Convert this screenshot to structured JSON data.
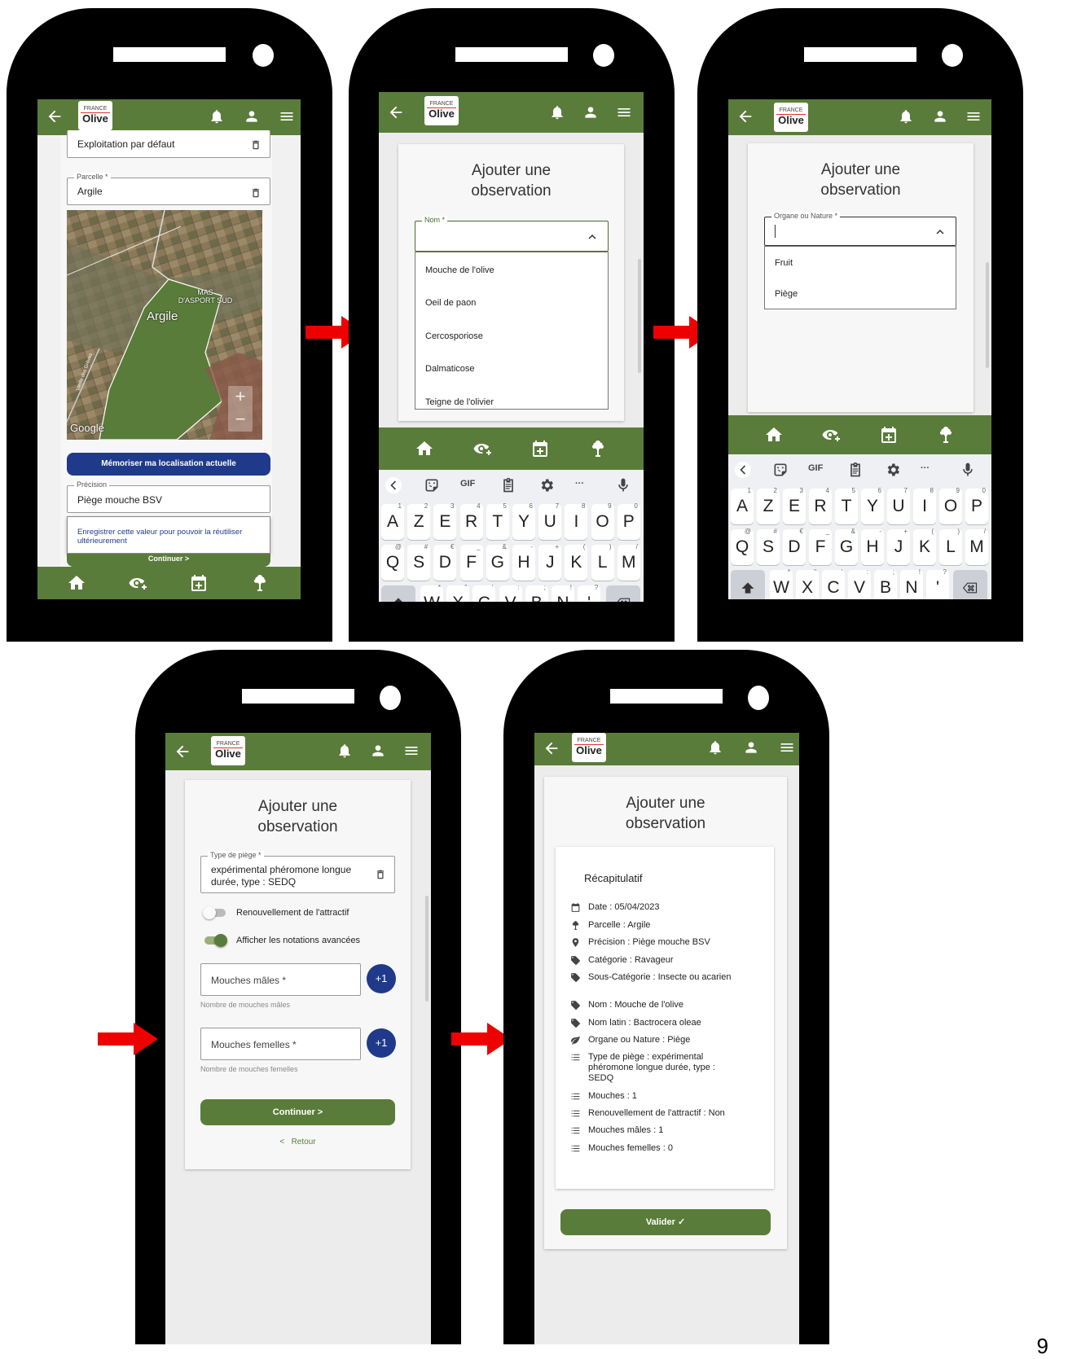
{
  "brand": {
    "logo_top": "FRANCE",
    "logo_main": "Olive"
  },
  "colors": {
    "green": "#5a7c3a",
    "blue": "#1f3a8a",
    "arrow": "#ee0000"
  },
  "screen1": {
    "exploitation_value": "Exploitation par défaut",
    "parcelle_label": "Parcelle *",
    "parcelle_value": "Argile",
    "map": {
      "mas_label": "MAS\nD'ASPORT SUD",
      "parcel_label": "Argile",
      "google": "Google",
      "road": "Vieille des Grèves",
      "zoom_in": "+",
      "zoom_out": "−"
    },
    "memorise_button": "Mémoriser ma localisation actuelle",
    "precision_label": "Précision",
    "precision_value": "Piège mouche BSV",
    "suggestion": "Enregistrer cette valeur pour pouvoir la réutiliser ultérieurement",
    "continue_button": "Continuer  >"
  },
  "screen2": {
    "title": "Ajouter une observation",
    "nom_label": "Nom *",
    "options": [
      "Mouche de l'olive",
      "Oeil de paon",
      "Cercosporiose",
      "Dalmaticose",
      "Teigne de l'olivier"
    ]
  },
  "screen3": {
    "title": "Ajouter une observation",
    "organe_label": "Organe ou Nature *",
    "options": [
      "Fruit",
      "Piège"
    ]
  },
  "keyboard": {
    "tools": [
      "GIF",
      "···"
    ],
    "row1": [
      "A",
      "Z",
      "E",
      "R",
      "T",
      "Y",
      "U",
      "I",
      "O",
      "P"
    ],
    "row1_alt": [
      "1",
      "2",
      "3",
      "4",
      "5",
      "6",
      "7",
      "8",
      "9",
      "0"
    ],
    "row2": [
      "Q",
      "S",
      "D",
      "F",
      "G",
      "H",
      "J",
      "K",
      "L",
      "M"
    ],
    "row2_alt": [
      "@",
      "#",
      "€",
      "_",
      "&",
      "-",
      "+",
      "(",
      ")",
      "/"
    ],
    "row3": [
      "W",
      "X",
      "C",
      "V",
      "B",
      "N",
      "'"
    ],
    "row3_alt": [
      "*",
      "\"",
      "'",
      ":",
      ";",
      "!",
      "?"
    ]
  },
  "screen4": {
    "title": "Ajouter une observation",
    "type_label": "Type de piège *",
    "type_value": "expérimental phéromone longue durée, type : SEDQ",
    "toggle1_label": "Renouvellement de l'attractif",
    "toggle2_label": "Afficher les notations avancées",
    "males_label": "Mouches mâles *",
    "males_hint": "Nombre de mouches mâles",
    "femelles_label": "Mouches femelles *",
    "femelles_hint": "Nombre de mouches femelles",
    "plus_label": "+1",
    "continue_button": "Continuer  >",
    "back_link": "<   Retour"
  },
  "screen5": {
    "title": "Ajouter une observation",
    "recap_title": "Récapitulatif",
    "rows": [
      {
        "icon": "calendar-icon",
        "text": "Date : 05/04/2023"
      },
      {
        "icon": "tree-icon",
        "text": "Parcelle : Argile"
      },
      {
        "icon": "location-pin-icon",
        "text": "Précision : Piège mouche BSV"
      },
      {
        "icon": "tag-icon",
        "text": "Catégorie : Ravageur"
      },
      {
        "icon": "tag-icon",
        "text": "Sous-Catégorie : Insecte ou acarien"
      },
      {
        "icon": "tag-icon",
        "text": "Nom : Mouche de l'olive"
      },
      {
        "icon": "tag-icon",
        "text": "Nom latin : Bactrocera oleae"
      },
      {
        "icon": "leaf-icon",
        "text": "Organe ou Nature : Piège"
      },
      {
        "icon": "list-icon",
        "text": "Type de piège : expérimental phéromone longue durée, type : SEDQ"
      },
      {
        "icon": "list-icon",
        "text": "Mouches : 1"
      },
      {
        "icon": "list-icon",
        "text": "Renouvellement de l'attractif : Non"
      },
      {
        "icon": "list-icon",
        "text": "Mouches mâles : 1"
      },
      {
        "icon": "list-icon",
        "text": "Mouches femelles : 0"
      }
    ],
    "validate_button": "Valider  ✓"
  },
  "page_number": "9"
}
